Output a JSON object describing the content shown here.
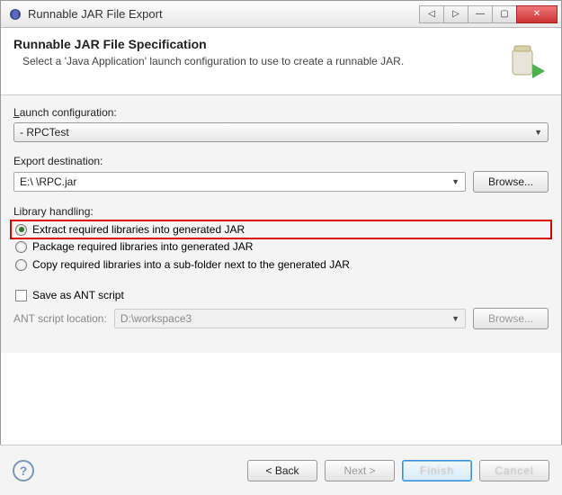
{
  "window": {
    "title": "Runnable JAR File Export"
  },
  "header": {
    "title": "Runnable JAR File Specification",
    "subtitle": "Select a 'Java Application' launch configuration to use to create a runnable JAR."
  },
  "launch": {
    "label": "Launch configuration:",
    "selected": "  - RPCTest"
  },
  "export": {
    "label": "Export destination:",
    "value": "E:\\           \\RPC.jar",
    "browse": "Browse..."
  },
  "library": {
    "label": "Library handling:",
    "options": [
      "Extract required libraries into generated JAR",
      "Package required libraries into generated JAR",
      "Copy required libraries into a sub-folder next to the generated JAR"
    ],
    "selected_index": 0
  },
  "ant": {
    "checkbox_label": "Save as ANT script",
    "location_label": "ANT script location:",
    "value": "D:\\workspace3",
    "browse": "Browse..."
  },
  "footer": {
    "back": "< Back",
    "next": "Next >",
    "finish": "Finish",
    "cancel": "Cancel"
  }
}
